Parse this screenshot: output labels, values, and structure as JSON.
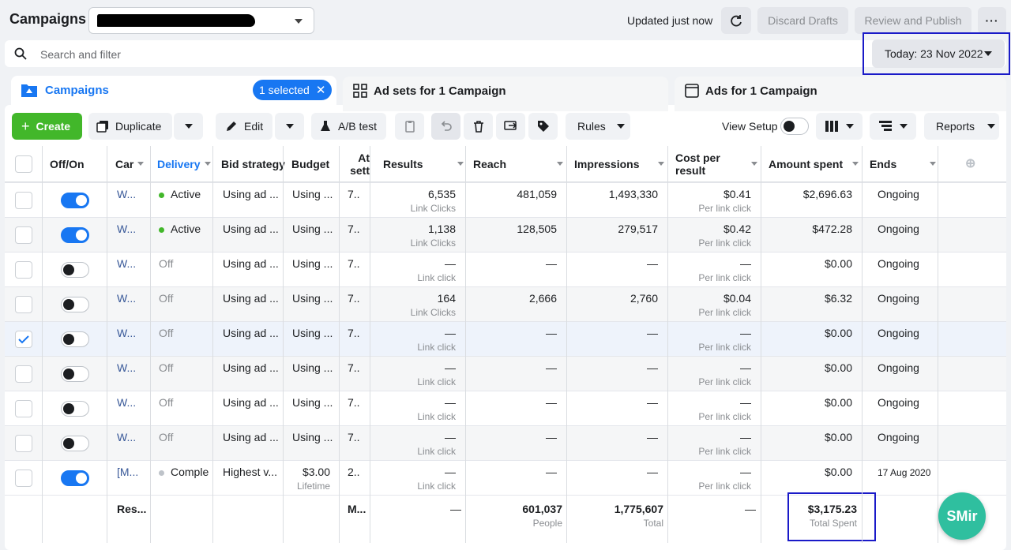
{
  "header": {
    "title": "Campaigns",
    "updated": "Updated just now",
    "discard": "Discard Drafts",
    "review": "Review and Publish",
    "more": "···"
  },
  "search": {
    "placeholder": "Search and filter"
  },
  "date_label": "Today: 23 Nov 2022",
  "tabs": {
    "campaigns": "Campaigns",
    "selected": "1 selected",
    "adsets": "Ad sets for 1 Campaign",
    "ads": "Ads for 1 Campaign"
  },
  "toolbar": {
    "create": "Create",
    "duplicate": "Duplicate",
    "edit": "Edit",
    "ab_test": "A/B test",
    "rules": "Rules",
    "view_setup": "View Setup",
    "reports": "Reports"
  },
  "columns": {
    "onoff": "Off/On",
    "campaign": "Car",
    "delivery": "Delivery",
    "bid": "Bid strategy",
    "budget": "Budget",
    "attr1": "At",
    "attr2": "sett",
    "results": "Results",
    "reach": "Reach",
    "impressions": "Impressions",
    "cpr1": "Cost per",
    "cpr2": "result",
    "spent": "Amount spent",
    "ends": "Ends"
  },
  "rows": [
    {
      "name": "W...",
      "on": true,
      "checked": false,
      "delivery": "Active",
      "dot": "#42b72a",
      "bid": "Using ad ...",
      "budget": "Using ...",
      "budget_sub": "",
      "attr": "7..",
      "results": "6,535",
      "results_sub": "Link Clicks",
      "reach": "481,059",
      "impressions": "1,493,330",
      "cpr": "$0.41",
      "cpr_sub": "Per link click",
      "spent": "$2,696.63",
      "ends": "Ongoing"
    },
    {
      "name": "W...",
      "on": true,
      "checked": false,
      "delivery": "Active",
      "dot": "#42b72a",
      "bid": "Using ad ...",
      "budget": "Using ...",
      "budget_sub": "",
      "attr": "7..",
      "results": "1,138",
      "results_sub": "Link Clicks",
      "reach": "128,505",
      "impressions": "279,517",
      "cpr": "$0.42",
      "cpr_sub": "Per link click",
      "spent": "$472.28",
      "ends": "Ongoing"
    },
    {
      "name": "W...",
      "on": false,
      "checked": false,
      "delivery": "Off",
      "dot": "",
      "bid": "Using ad ...",
      "budget": "Using ...",
      "budget_sub": "",
      "attr": "7..",
      "results": "—",
      "results_sub": "Link click",
      "reach": "—",
      "impressions": "—",
      "cpr": "—",
      "cpr_sub": "Per link click",
      "spent": "$0.00",
      "ends": "Ongoing"
    },
    {
      "name": "W...",
      "on": false,
      "checked": false,
      "delivery": "Off",
      "dot": "",
      "bid": "Using ad ...",
      "budget": "Using ...",
      "budget_sub": "",
      "attr": "7..",
      "results": "164",
      "results_sub": "Link Clicks",
      "reach": "2,666",
      "impressions": "2,760",
      "cpr": "$0.04",
      "cpr_sub": "Per link click",
      "spent": "$6.32",
      "ends": "Ongoing"
    },
    {
      "name": "W...",
      "on": false,
      "checked": true,
      "delivery": "Off",
      "dot": "",
      "bid": "Using ad ...",
      "budget": "Using ...",
      "budget_sub": "",
      "attr": "7..",
      "results": "—",
      "results_sub": "Link click",
      "reach": "—",
      "impressions": "—",
      "cpr": "—",
      "cpr_sub": "Per link click",
      "spent": "$0.00",
      "ends": "Ongoing"
    },
    {
      "name": "W...",
      "on": false,
      "checked": false,
      "delivery": "Off",
      "dot": "",
      "bid": "Using ad ...",
      "budget": "Using ...",
      "budget_sub": "",
      "attr": "7..",
      "results": "—",
      "results_sub": "Link click",
      "reach": "—",
      "impressions": "—",
      "cpr": "—",
      "cpr_sub": "Per link click",
      "spent": "$0.00",
      "ends": "Ongoing"
    },
    {
      "name": "W...",
      "on": false,
      "checked": false,
      "delivery": "Off",
      "dot": "",
      "bid": "Using ad ...",
      "budget": "Using ...",
      "budget_sub": "",
      "attr": "7..",
      "results": "—",
      "results_sub": "Link click",
      "reach": "—",
      "impressions": "—",
      "cpr": "—",
      "cpr_sub": "Per link click",
      "spent": "$0.00",
      "ends": "Ongoing"
    },
    {
      "name": "W...",
      "on": false,
      "checked": false,
      "delivery": "Off",
      "dot": "",
      "bid": "Using ad ...",
      "budget": "Using ...",
      "budget_sub": "",
      "attr": "7..",
      "results": "—",
      "results_sub": "Link click",
      "reach": "—",
      "impressions": "—",
      "cpr": "—",
      "cpr_sub": "Per link click",
      "spent": "$0.00",
      "ends": "Ongoing"
    },
    {
      "name": "[M...",
      "on": true,
      "checked": false,
      "delivery": "Comple",
      "dot": "#bec3c9",
      "bid": "Highest v...",
      "budget": "$3.00",
      "budget_sub": "Lifetime",
      "attr": "2..",
      "results": "—",
      "results_sub": "Link click",
      "reach": "—",
      "impressions": "—",
      "cpr": "—",
      "cpr_sub": "Per link click",
      "spent": "$0.00",
      "ends": "17 Aug 2020"
    }
  ],
  "totals": {
    "label": "Res...",
    "attr": "M...",
    "results": "—",
    "reach": "601,037",
    "reach_sub": "People",
    "impressions": "1,775,607",
    "impressions_sub": "Total",
    "cpr": "—",
    "spent": "$3,175.23",
    "spent_sub": "Total Spent"
  },
  "badge": "SMir",
  "colors": {
    "accent": "#1877f2",
    "create": "#42b72a",
    "highlight": "#1a1ac8"
  }
}
